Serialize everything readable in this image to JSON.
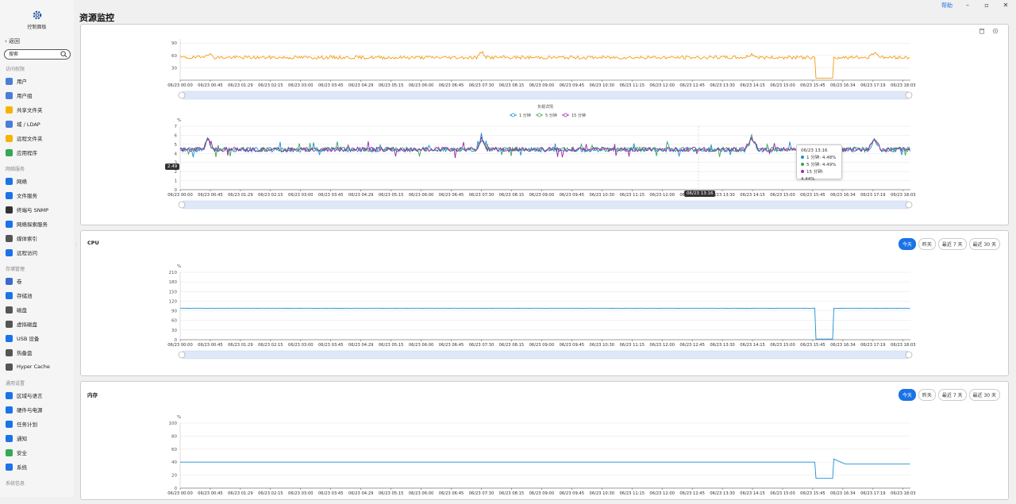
{
  "window": {
    "help_label": "帮助"
  },
  "sidebar": {
    "title": "控制面板",
    "back_label": "返回",
    "search_placeholder": "搜索",
    "sections": [
      {
        "label": "访问权限",
        "items": [
          {
            "label": "用户",
            "color": "#4a7fd6"
          },
          {
            "label": "用户组",
            "color": "#4a7fd6"
          },
          {
            "label": "共享文件夹",
            "color": "#f6b400"
          },
          {
            "label": "域 / LDAP",
            "color": "#4a7fd6"
          },
          {
            "label": "远程文件夹",
            "color": "#f6b400"
          },
          {
            "label": "应用程序",
            "color": "#34a853"
          }
        ]
      },
      {
        "label": "网络服务",
        "items": [
          {
            "label": "网络",
            "color": "#1a73e8"
          },
          {
            "label": "文件服务",
            "color": "#1a73e8"
          },
          {
            "label": "终端与 SNMP",
            "color": "#333333"
          },
          {
            "label": "网络探索服务",
            "color": "#1a73e8"
          },
          {
            "label": "媒体索引",
            "color": "#555555"
          },
          {
            "label": "远程访问",
            "color": "#1a73e8"
          }
        ]
      },
      {
        "label": "存储管理",
        "items": [
          {
            "label": "卷",
            "color": "#3a6bc9"
          },
          {
            "label": "存储池",
            "color": "#1a73e8"
          },
          {
            "label": "磁盘",
            "color": "#555555"
          },
          {
            "label": "虚拟磁盘",
            "color": "#555555"
          },
          {
            "label": "USB 设备",
            "color": "#1a73e8"
          },
          {
            "label": "热备盘",
            "color": "#555555"
          },
          {
            "label": "Hyper Cache",
            "color": "#555555"
          }
        ]
      },
      {
        "label": "通用设置",
        "items": [
          {
            "label": "区域与语言",
            "color": "#1a73e8"
          },
          {
            "label": "硬件与电源",
            "color": "#1a73e8"
          },
          {
            "label": "任务计划",
            "color": "#1a73e8"
          },
          {
            "label": "通知",
            "color": "#1a73e8"
          },
          {
            "label": "安全",
            "color": "#34a853"
          },
          {
            "label": "系统",
            "color": "#1a73e8"
          }
        ]
      },
      {
        "label": "系统信息",
        "items": []
      }
    ]
  },
  "main": {
    "title": "资源监控"
  },
  "x_ticks": [
    "06/23 00:00",
    "06/23 00:45",
    "06/23 01:29",
    "06/23 02:15",
    "06/23 03:00",
    "06/23 03:45",
    "06/23 04:29",
    "06/23 05:15",
    "06/23 06:00",
    "06/23 06:45",
    "06/23 07:30",
    "06/23 08:15",
    "06/23 09:00",
    "06/23 09:45",
    "06/23 10:30",
    "06/23 11:15",
    "06/23 12:00",
    "06/23 12:45",
    "06/23 13:30",
    "06/23 14:15",
    "06/23 15:00",
    "06/23 15:45",
    "06/23 16:34",
    "06/23 17:19",
    "06/23 18:03"
  ],
  "tabs": [
    "今天",
    "昨天",
    "最近 7 天",
    "最近 30 天"
  ],
  "tooltip": {
    "time": "06/23 13:16",
    "rows": [
      {
        "label": "1 分钟: 4.48%",
        "color": "#1a8fd6"
      },
      {
        "label": "5 分钟: 4.49%",
        "color": "#34a853"
      },
      {
        "label": "15 分钟: 4.44%",
        "color": "#9c27b0"
      }
    ]
  },
  "cursor_badges": {
    "y_value": "2.49",
    "x_value": "06/23 13:16"
  },
  "chart_data": [
    {
      "type": "line",
      "title": "",
      "yticks": [
        "30",
        "60",
        "90"
      ],
      "ylim": [
        0,
        100
      ],
      "series": [
        {
          "color": "#f39c12",
          "baseline": 55,
          "dip_range": [
            "06/23 15:45",
            "06/23 16:15"
          ],
          "dip_value": 5
        }
      ]
    },
    {
      "type": "line",
      "title": "负载详情",
      "ylabel": "%",
      "yticks": [
        "0",
        "1",
        "2",
        "3",
        "4",
        "5",
        "6",
        "7"
      ],
      "ylim": [
        0,
        7
      ],
      "legend": [
        "1 分钟",
        "5 分钟",
        "15 分钟"
      ],
      "legend_position": "top-center",
      "series": [
        {
          "name": "1 分钟",
          "color": "#1a8fd6",
          "baseline": 4.4
        },
        {
          "name": "5 分钟",
          "color": "#34a853",
          "baseline": 4.45
        },
        {
          "name": "15 分钟",
          "color": "#9c27b0",
          "baseline": 4.44
        }
      ]
    },
    {
      "type": "line",
      "title": "CPU",
      "ylabel": "%",
      "yticks": [
        "0",
        "30",
        "60",
        "90",
        "120",
        "150",
        "180",
        "210"
      ],
      "ylim": [
        0,
        210
      ],
      "series": [
        {
          "color": "#1a8fd6",
          "baseline": 98,
          "dip_range": [
            "06/23 15:45",
            "06/23 16:15"
          ],
          "dip_value": 2
        }
      ]
    },
    {
      "type": "line",
      "title": "内存",
      "ylabel": "%",
      "yticks": [
        "0",
        "20",
        "40",
        "60",
        "80",
        "100"
      ],
      "ylim": [
        0,
        100
      ],
      "series": [
        {
          "color": "#1a8fd6",
          "baseline": 40,
          "dip_range": [
            "06/23 15:45",
            "06/23 16:15"
          ],
          "dip_value": 15,
          "after_value": 37
        }
      ]
    }
  ]
}
